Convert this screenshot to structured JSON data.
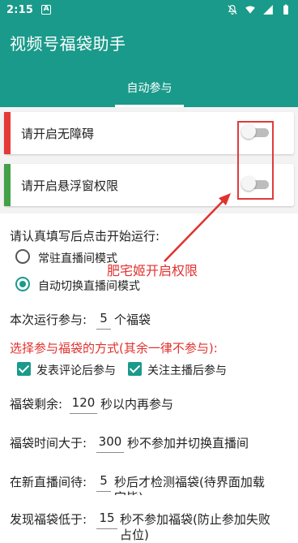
{
  "status_bar": {
    "time": "2:15",
    "badge": "A",
    "icons": [
      "notifications-off-icon",
      "wifi-icon",
      "signal-icon",
      "battery-icon"
    ]
  },
  "app": {
    "title": "视频号福袋助手",
    "tab_label": "自动参与"
  },
  "cards": [
    {
      "label": "请开启无障碍",
      "accent": "#e53935",
      "enabled": false
    },
    {
      "label": "请开启悬浮窗权限",
      "accent": "#43a047",
      "enabled": false
    }
  ],
  "annotation": {
    "text": "肥宅姬开启权限",
    "color": "#e0322f"
  },
  "settings": {
    "intro": "请认真填写后点击开始运行:",
    "modes": [
      {
        "label": "常驻直播间模式",
        "selected": false
      },
      {
        "label": "自动切换直播间模式",
        "selected": true
      }
    ],
    "run_count": {
      "prefix": "本次运行参与:",
      "value": "5",
      "suffix": "个福袋"
    },
    "method_title": "选择参与福袋的方式(其余一律不参与):",
    "methods": [
      {
        "label": "发表评论后参与",
        "checked": true
      },
      {
        "label": "关注主播后参与",
        "checked": true
      }
    ],
    "remaining": {
      "prefix": "福袋剩余:",
      "value": "120",
      "suffix": "秒以内再参与"
    },
    "time_greater": {
      "prefix": "福袋时间大于:",
      "value": "300",
      "suffix": "秒不参加并切换直播间"
    },
    "wait_new": {
      "prefix": "在新直播间待:",
      "value": "5",
      "suffix": "秒后才检测福袋(待界面加载",
      "suffix_cut": "完毕)"
    },
    "found_less": {
      "prefix": "发现福袋低于:",
      "value": "15",
      "suffix": "秒不参加福袋(防止参加失败",
      "suffix_cut": "占位)"
    }
  },
  "colors": {
    "primary": "#1a9a8a",
    "highlight_red": "#e0322f"
  }
}
